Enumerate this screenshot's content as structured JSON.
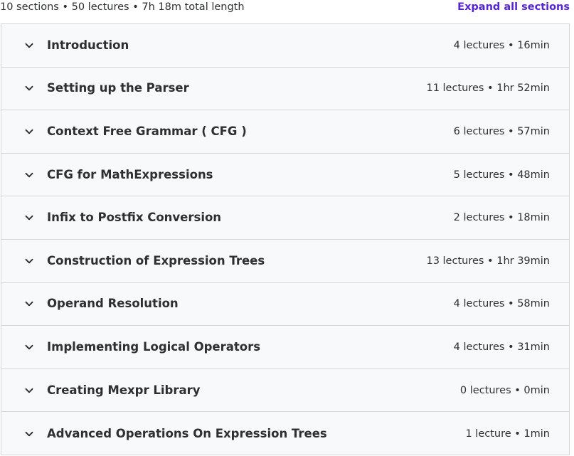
{
  "header": {
    "summary": "10 sections • 50 lectures • 7h 18m total length",
    "expand_all_label": "Expand all sections"
  },
  "sections": [
    {
      "title": "Introduction",
      "meta": "4 lectures • 16min"
    },
    {
      "title": "Setting up the Parser",
      "meta": "11 lectures • 1hr 52min"
    },
    {
      "title": "Context Free Grammar ( CFG )",
      "meta": "6 lectures • 57min"
    },
    {
      "title": "CFG for MathExpressions",
      "meta": "5 lectures • 48min"
    },
    {
      "title": "Infix to Postfix Conversion",
      "meta": "2 lectures • 18min"
    },
    {
      "title": "Construction of Expression Trees",
      "meta": "13 lectures • 1hr 39min"
    },
    {
      "title": "Operand Resolution",
      "meta": "4 lectures • 58min"
    },
    {
      "title": "Implementing Logical Operators",
      "meta": "4 lectures • 31min"
    },
    {
      "title": "Creating Mexpr Library",
      "meta": "0 lectures • 0min"
    },
    {
      "title": "Advanced Operations On Expression Trees",
      "meta": "1 lecture • 1min"
    }
  ],
  "icons": {
    "section_toggle": "chevron-down-icon"
  },
  "colors": {
    "accent": "#5624d0",
    "text": "#2d2f31",
    "row_background": "#f7f9fa",
    "border": "#d1d7dc"
  }
}
